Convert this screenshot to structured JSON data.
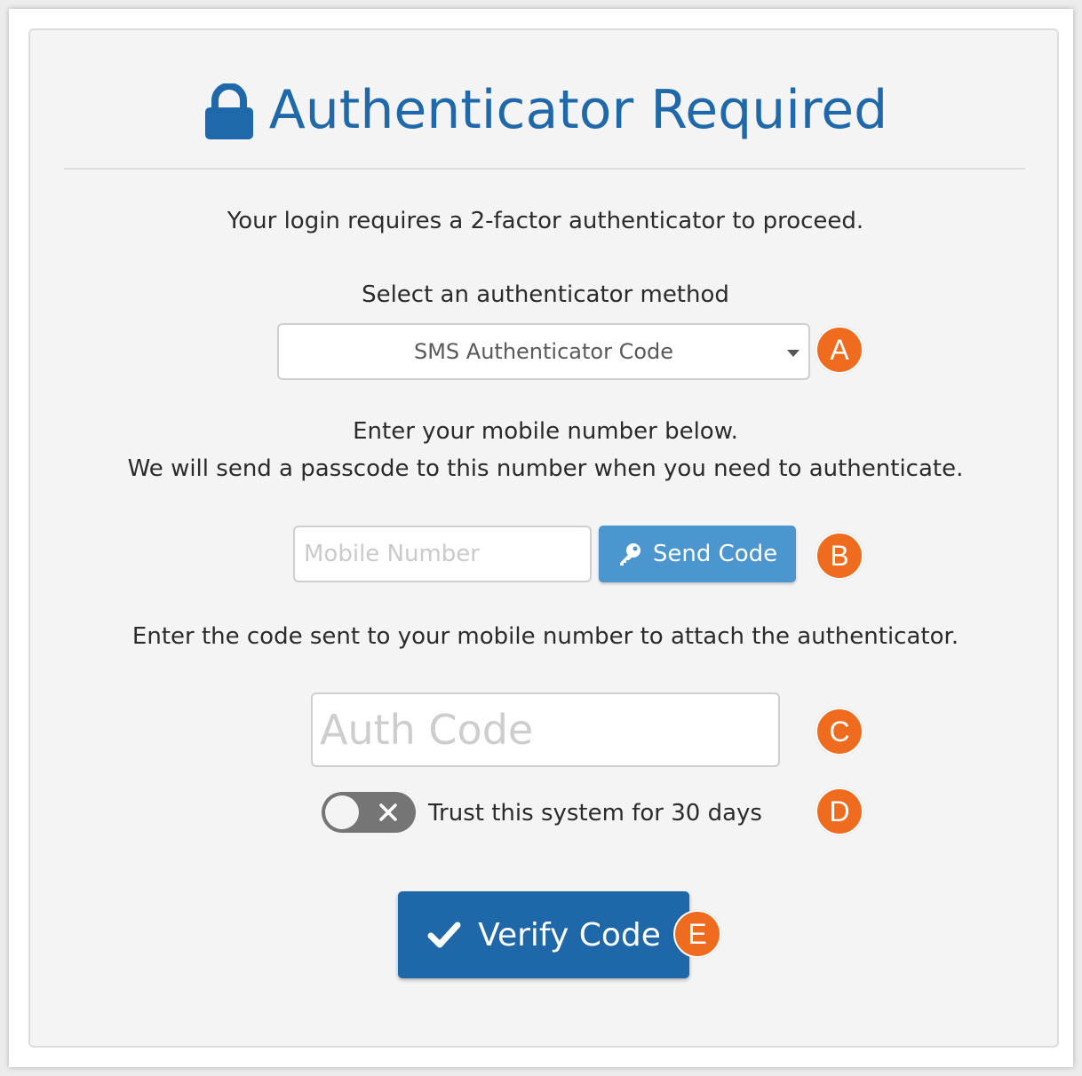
{
  "page": {
    "title": "Authenticator Required",
    "intro": "Your login requires a 2-factor authenticator to proceed.",
    "method_label": "Select an authenticator method",
    "method_selected": "SMS Authenticator Code",
    "mobile_instructions_line1": "Enter your mobile number below.",
    "mobile_instructions_line2": "We will send a passcode to this number when you need to authenticate.",
    "mobile_placeholder": "Mobile Number",
    "send_code_label": "Send Code",
    "code_instructions": "Enter the code sent to your mobile number to attach the authenticator.",
    "auth_code_placeholder": "Auth Code",
    "trust_label": "Trust this system for 30 days",
    "trust_enabled": false,
    "verify_label": "Verify Code"
  },
  "callouts": {
    "a": "A",
    "b": "B",
    "c": "C",
    "d": "D",
    "e": "E"
  },
  "colors": {
    "title": "#1f69aa",
    "callout": "#ef6c1e",
    "send_button": "#4b96ce",
    "verify_button": "#1e67a8",
    "toggle_off": "#757575"
  },
  "icons": {
    "title": "lock-icon",
    "method_select": "caret-down-icon",
    "send_button": "key-icon",
    "toggle": "close-icon",
    "verify_button": "checkmark-icon"
  }
}
